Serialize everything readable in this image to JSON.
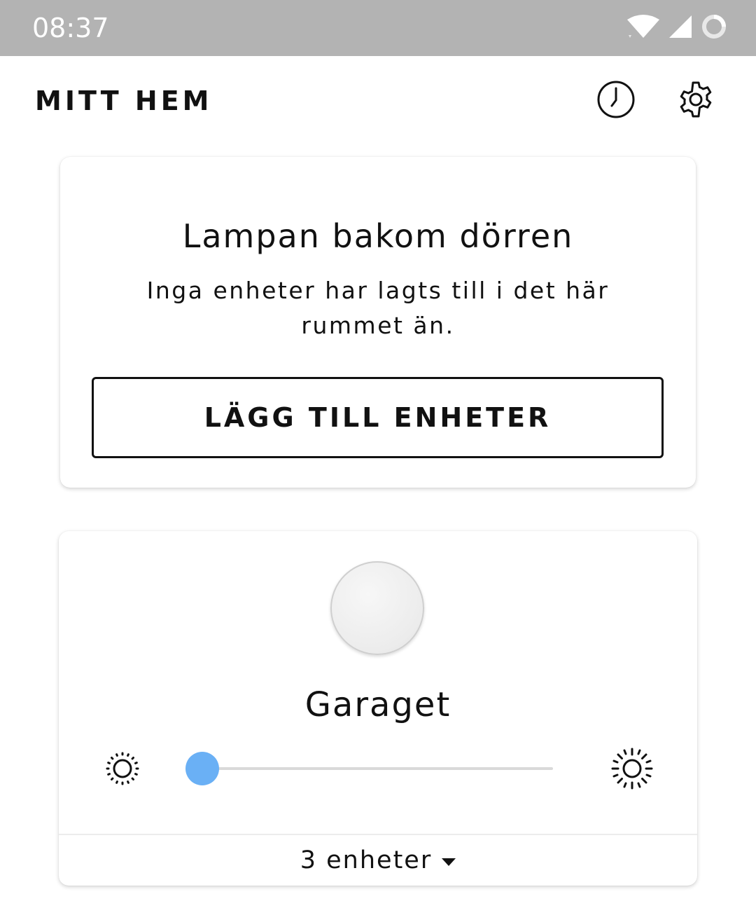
{
  "status_bar": {
    "time": "08:37",
    "icons": [
      "wifi-icon",
      "cell-signal-icon",
      "sync-icon"
    ],
    "background": "#b3b3b3"
  },
  "header": {
    "title": "MITT HEM",
    "icons": [
      "history-clock-icon",
      "gear-icon"
    ]
  },
  "rooms": [
    {
      "name": "Lampan bakom dörren",
      "empty_message": "Inga enheter har lagts till i det här rummet än.",
      "add_button_label": "LÄGG TILL ENHETER"
    },
    {
      "name": "Garaget",
      "brightness": 0,
      "device_count_label": "3 enheter",
      "accent": "#6ab0f5"
    }
  ]
}
